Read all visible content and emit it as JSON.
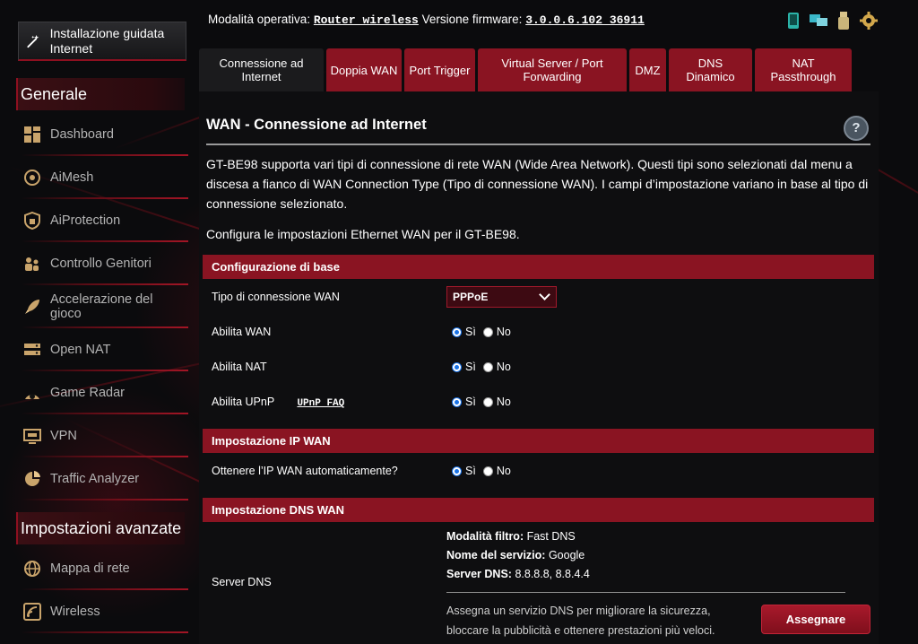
{
  "sidebar": {
    "quick_setup": "Installazione guidata Internet",
    "general_title": "Generale",
    "general_items": [
      {
        "label": "Dashboard",
        "icon": "dashboard-icon"
      },
      {
        "label": "AiMesh",
        "icon": "aimesh-icon"
      },
      {
        "label": "AiProtection",
        "icon": "shield-icon"
      },
      {
        "label": "Controllo Genitori",
        "icon": "parental-control-icon"
      },
      {
        "label": "Accelerazione del gioco",
        "icon": "rocket-icon"
      },
      {
        "label": "Open NAT",
        "icon": "open-nat-icon"
      },
      {
        "label": "Game Radar",
        "icon": "game-radar-icon"
      },
      {
        "label": "VPN",
        "icon": "vpn-icon"
      },
      {
        "label": "Traffic Analyzer",
        "icon": "traffic-analyzer-icon"
      }
    ],
    "advanced_title": "Impostazioni avanzate",
    "advanced_items": [
      {
        "label": "Mappa di rete",
        "icon": "globe-icon"
      },
      {
        "label": "Wireless",
        "icon": "wireless-icon"
      }
    ]
  },
  "topbar": {
    "mode_label": "Modalità operativa:",
    "mode_value": "Router wireless",
    "firmware_label": "Versione firmware:",
    "firmware_value": "3.0.0.6.102_36911"
  },
  "tabs": [
    {
      "label": "Connessione ad Internet",
      "active": true
    },
    {
      "label": "Doppia WAN"
    },
    {
      "label": "Port Trigger"
    },
    {
      "label": "Virtual Server / Port Forwarding"
    },
    {
      "label": "DMZ"
    },
    {
      "label": "DNS Dinamico"
    },
    {
      "label": "NAT Passthrough"
    }
  ],
  "main": {
    "title": "WAN - Connessione ad Internet",
    "help": "?",
    "description": "GT-BE98 supporta vari tipi di connessione di rete WAN (Wide Area Network). Questi tipi sono selezionati dal menu a discesa a fianco di WAN Connection Type (Tipo di connessione WAN). I campi d’impostazione variano in base al tipo di connessione selezionato.",
    "description2": "Configura le impostazioni Ethernet WAN per il GT-BE98."
  },
  "basic": {
    "header": "Configurazione di base",
    "wan_type_label": "Tipo di connessione WAN",
    "wan_type_value": "PPPoE",
    "enable_wan_label": "Abilita WAN",
    "enable_nat_label": "Abilita NAT",
    "enable_upnp_label": "Abilita UPnP",
    "upnp_faq": "UPnP FAQ",
    "yes": "Sì",
    "no": "No"
  },
  "ip": {
    "header": "Impostazione IP WAN",
    "auto_label": "Ottenere l’IP WAN automaticamente?"
  },
  "dns": {
    "header": "Impostazione DNS WAN",
    "server_label": "Server DNS",
    "filter_label": "Modalità filtro:",
    "filter_value": "Fast DNS",
    "service_label": "Nome del servizio:",
    "service_value": "Google",
    "server_key": "Server DNS:",
    "server_value": "8.8.8.8, 8.8.4.4",
    "note": "Assegna un servizio DNS per migliorare la sicurezza, bloccare la pubblicità e ottenere prestazioni più veloci.",
    "assign": "Assegnare"
  }
}
